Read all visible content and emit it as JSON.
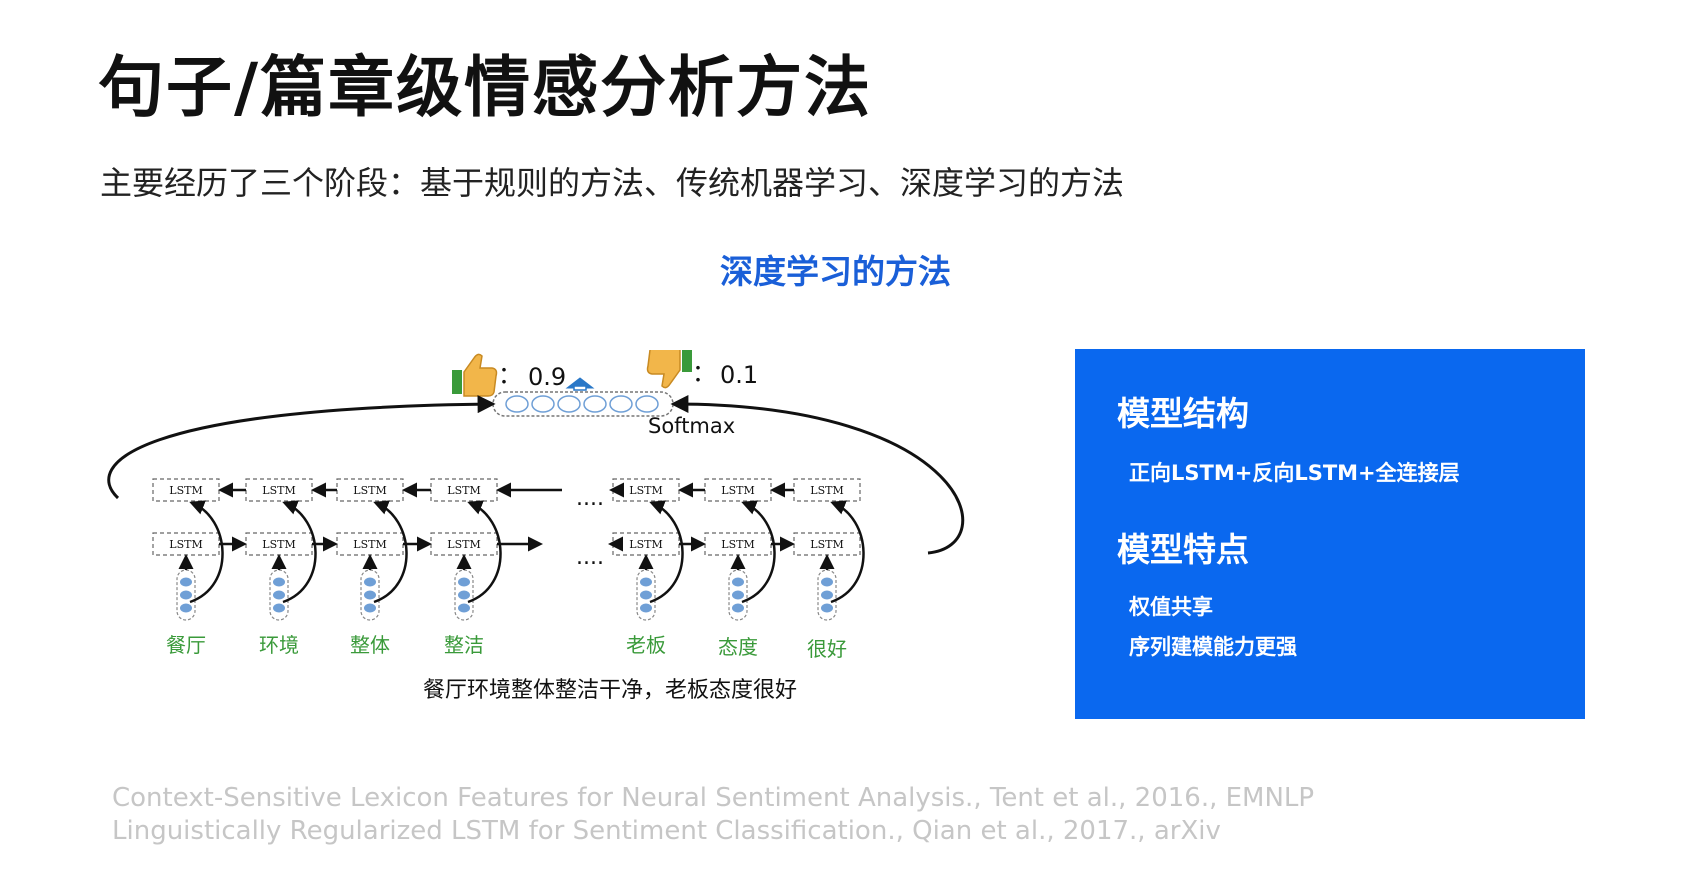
{
  "slide": {
    "title": "句子/篇章级情感分析方法",
    "subtitle": "主要经历了三个阶段：基于规则的方法、传统机器学习、深度学习的方法",
    "section_heading": "深度学习的方法"
  },
  "diagram": {
    "scores": {
      "positive_value": "0.9",
      "negative_value": "0.1",
      "separator": "："
    },
    "softmax_label": "Softmax",
    "cell_label": "LSTM",
    "ellipsis": "....",
    "words": [
      "餐厅",
      "环境",
      "整体",
      "整洁",
      "老板",
      "态度",
      "很好"
    ],
    "sentence": "餐厅环境整体整洁干净，老板态度很好",
    "colors": {
      "word": "#3a9a3a",
      "token": "#6f9fd6",
      "arrow_up": "#2a78c8"
    }
  },
  "panel": {
    "color": "#0a68ef",
    "structure_heading": "模型结构",
    "structure_text": "正向LSTM+反向LSTM+全连接层",
    "features_heading": "模型特点",
    "features": [
      "权值共享",
      "序列建模能力更强"
    ]
  },
  "references": [
    "Context-Sensitive Lexicon Features for Neural Sentiment Analysis., Tent et al., 2016., EMNLP",
    "Linguistically Regularized LSTM for Sentiment Classification., Qian et al., 2017., arXiv"
  ]
}
